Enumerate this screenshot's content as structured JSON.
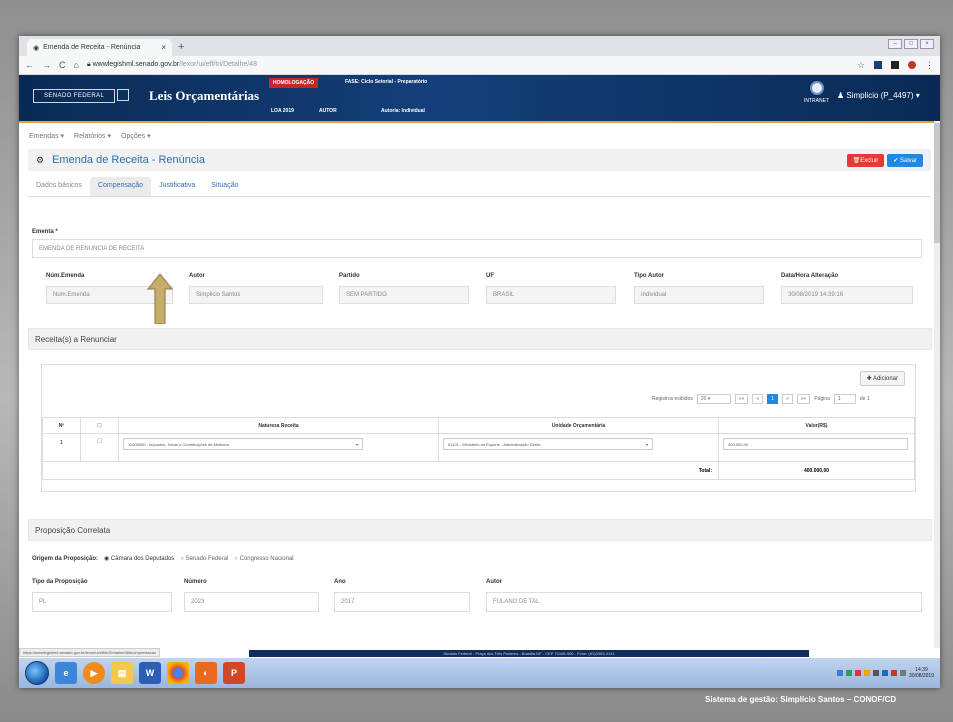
{
  "browser": {
    "tab_title": "Emenda de Receita - Renúncia",
    "tab_close": "×",
    "new_tab": "+",
    "nav": [
      "←",
      "→",
      "C",
      "⌂"
    ],
    "url_host": "wwwlegishml.senado.gov.br",
    "url_path": "/lexor/ui/eff/tri/Detalhe/48",
    "star": "☆"
  },
  "header": {
    "senado_label": "SENADO FEDERAL",
    "app_title": "Leis Orçamentárias",
    "env_badge": "HOMOLOGAÇÃO",
    "phase": "FASE: Ciclo Setorial - Preparatório",
    "row": [
      "LOA 2019",
      "AUTOR",
      "Autoria: Individual"
    ],
    "intranet": "INTRANET",
    "user": "Simplicio (P_4497)",
    "user_caret": "▾"
  },
  "menu": {
    "items": [
      "Emendas ▾",
      "Relatórios ▾",
      "Opções ▾"
    ]
  },
  "page": {
    "icon": "⚙",
    "title": "Emenda de Receita - Renúncia",
    "delete_label": "Excluir",
    "save_label": "✔ Salvar",
    "tabs": [
      "Dados básicos",
      "Compensação",
      "Justificativa",
      "Situação"
    ]
  },
  "form": {
    "ementa_label": "Ementa *",
    "ementa_value": "EMENDA DE RENUNCIA DE RECEITA",
    "fields": [
      {
        "label": "Núm.Emenda",
        "value": "Num.Emenda"
      },
      {
        "label": "Autor",
        "value": "Simplicio Santos"
      },
      {
        "label": "Partido",
        "value": "SEM PARTIDO"
      },
      {
        "label": "UF",
        "value": "BRASIL"
      },
      {
        "label": "Tipo Autor",
        "value": "Individual"
      },
      {
        "label": "Data/Hora Alteração",
        "value": "30/08/2019 14:39:16"
      }
    ]
  },
  "receitas": {
    "section_title": "Receita(s) a Renunciar",
    "add_label": "✚ Adicionar",
    "registros_label": "Registros exibidos",
    "registros_value": "20",
    "pager": [
      "««",
      "«",
      "1",
      "»",
      "»»"
    ],
    "pagina_label": "Página",
    "pagina_value": "1",
    "pagina_total": "de 1",
    "columns": [
      "Nº",
      "☐",
      "Natureza Receita",
      "Unidade Orçamentária",
      "Valor(R$)"
    ],
    "rows": [
      {
        "num": "1",
        "check": "☐",
        "natureza": "11000000 - Impostos, Taxas e Contribuições de Melhoria",
        "unidade": "51101 - Ministério do Esporte - Administração Direta",
        "valor": "400.000,00"
      }
    ],
    "total_label": "Total:",
    "total_value": "400.000,00"
  },
  "proposicao": {
    "section_title": "Proposição Correlata",
    "origem_label": "Origem da Proposição:",
    "options": [
      {
        "label": "Câmara dos Deputados",
        "selected": true
      },
      {
        "label": "Senado Federal",
        "selected": false
      },
      {
        "label": "Congresso Nacional",
        "selected": false
      }
    ],
    "fields": [
      {
        "label": "Tipo da Proposição",
        "value": "PL"
      },
      {
        "label": "Número",
        "value": "2023"
      },
      {
        "label": "Ano",
        "value": "2017"
      },
      {
        "label": "Autor",
        "value": "FULANO DE TAL"
      }
    ]
  },
  "status_url": "https://wwwlegishml.senado.gov.br/lexor/ui/eff/tri/Detalhe/48#compensacao",
  "footer_text": "Senado Federal - Praça dos Três Poderes - Brasília DF - CEP 70165-900 - Fone: (61)3303-4141",
  "taskbar": {
    "apps": [
      "W",
      "P"
    ],
    "time": "14:39",
    "date": "30/08/2019"
  },
  "credit": "Sistema de gestão: Simplício Santos – CONOF/CD",
  "colors": {
    "header_bg": "#143f7a",
    "accent_blue": "#2f6fb1",
    "delete_red": "#e53935",
    "save_blue": "#1e88e5",
    "arrow_fill": "#c8ac6a"
  }
}
